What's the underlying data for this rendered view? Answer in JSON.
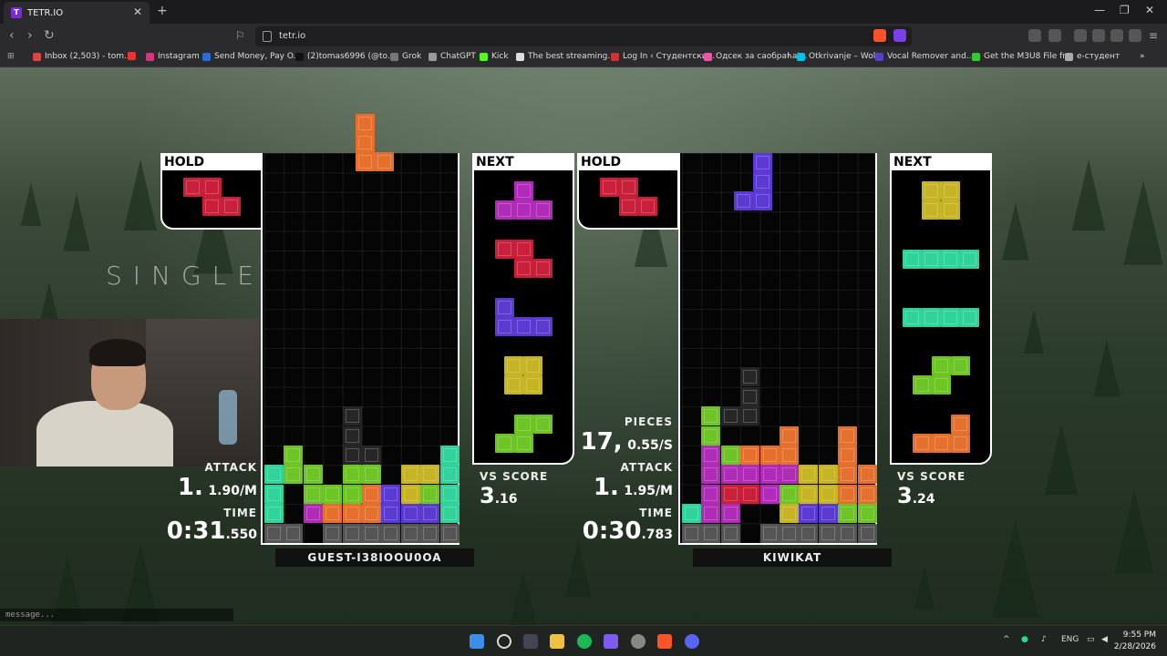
{
  "browser": {
    "tab_title": "TETR.IO",
    "url": "tetr.io",
    "bookmarks": [
      {
        "label": "Inbox (2,503) - tom...",
        "color": "#d44"
      },
      {
        "label": "",
        "color": "#e33"
      },
      {
        "label": "Instagram",
        "color": "#d3377a"
      },
      {
        "label": "Send Money, Pay O...",
        "color": "#2b6cd6"
      },
      {
        "label": "(2)tomas6996 (@to...",
        "color": "#111"
      },
      {
        "label": "Grok",
        "color": "#777"
      },
      {
        "label": "ChatGPT",
        "color": "#999"
      },
      {
        "label": "Kick",
        "color": "#53fc18"
      },
      {
        "label": "The best streaming...",
        "color": "#ddd"
      },
      {
        "label": "Log In ‹ Студентски...",
        "color": "#c33"
      },
      {
        "label": "Одсек за саобраћај...",
        "color": "#e5a"
      },
      {
        "label": "Otkrivanje – Wolt",
        "color": "#00c2e8"
      },
      {
        "label": "Vocal Remover and...",
        "color": "#5b3fc9"
      },
      {
        "label": "Get the M3U8 File fr...",
        "color": "#3c3"
      },
      {
        "label": "е-студент",
        "color": "#aaa"
      }
    ]
  },
  "game": {
    "mode_label": "SINGLE",
    "hold_label": "HOLD",
    "next_label": "NEXT",
    "pieces_label": "PIECES",
    "attack_label": "ATTACK",
    "time_label": "TIME",
    "vs_score_label": "VS SCORE",
    "chat_placeholder": "message...",
    "colors": {
      "Z": "#c8203a",
      "T": "#b02bb8",
      "J": "#5a3ad0",
      "O": "#c6b424",
      "S": "#6cc425",
      "L": "#e56f2c",
      "I": "#30d49b",
      "G": "#555555",
      "X": "#262626"
    },
    "players": [
      {
        "name": "GUEST-I38IOOU0OA",
        "hold_piece": "Z",
        "next_queue": [
          "T",
          "Z",
          "J",
          "O",
          "S"
        ],
        "attack_big": "1.",
        "attack_small": "1.90/M",
        "time_big": "0:31",
        "time_small": ".550",
        "vs_score_big": "3",
        "vs_score_small": ".16",
        "falling_piece": "L",
        "board_rows": [
          "..........",
          "..........",
          "..........",
          "..........",
          "..........",
          "..........",
          "..........",
          "..........",
          "..........",
          "..........",
          "..........",
          "..........",
          "..........",
          "....X.....",
          "....X.....",
          ".S..XX...I",
          "ISS.SS.OOI",
          "I.SSSLJOSI",
          "I.TLLLJJJI",
          "GG.GGGGGGG"
        ]
      },
      {
        "name": "KIWIKAT",
        "hold_piece": "Z",
        "next_queue": [
          "O",
          "I",
          "I",
          "S",
          "L"
        ],
        "pieces_big": "17,",
        "pieces_small": "0.55/S",
        "attack_big": "1.",
        "attack_small": "1.95/M",
        "time_big": "0:30",
        "time_small": ".783",
        "vs_score_big": "3",
        "vs_score_small": ".24",
        "falling_piece": "J",
        "board_rows": [
          "..........",
          "..........",
          "..........",
          "..........",
          "..........",
          "..........",
          "..........",
          "..........",
          "..........",
          "..........",
          "..........",
          "..........",
          "...X......",
          "...X......",
          ".SXX......",
          ".S...L..L.",
          ".TSLLL..L.",
          ".TTTTTOOLL",
          ".TZZTSOOLL",
          "ITT..OJJSS",
          "GGG.GGGGGG"
        ]
      }
    ]
  },
  "taskbar": {
    "language": "ENG",
    "time": "9:55 PM",
    "date": "2/28/2026"
  }
}
